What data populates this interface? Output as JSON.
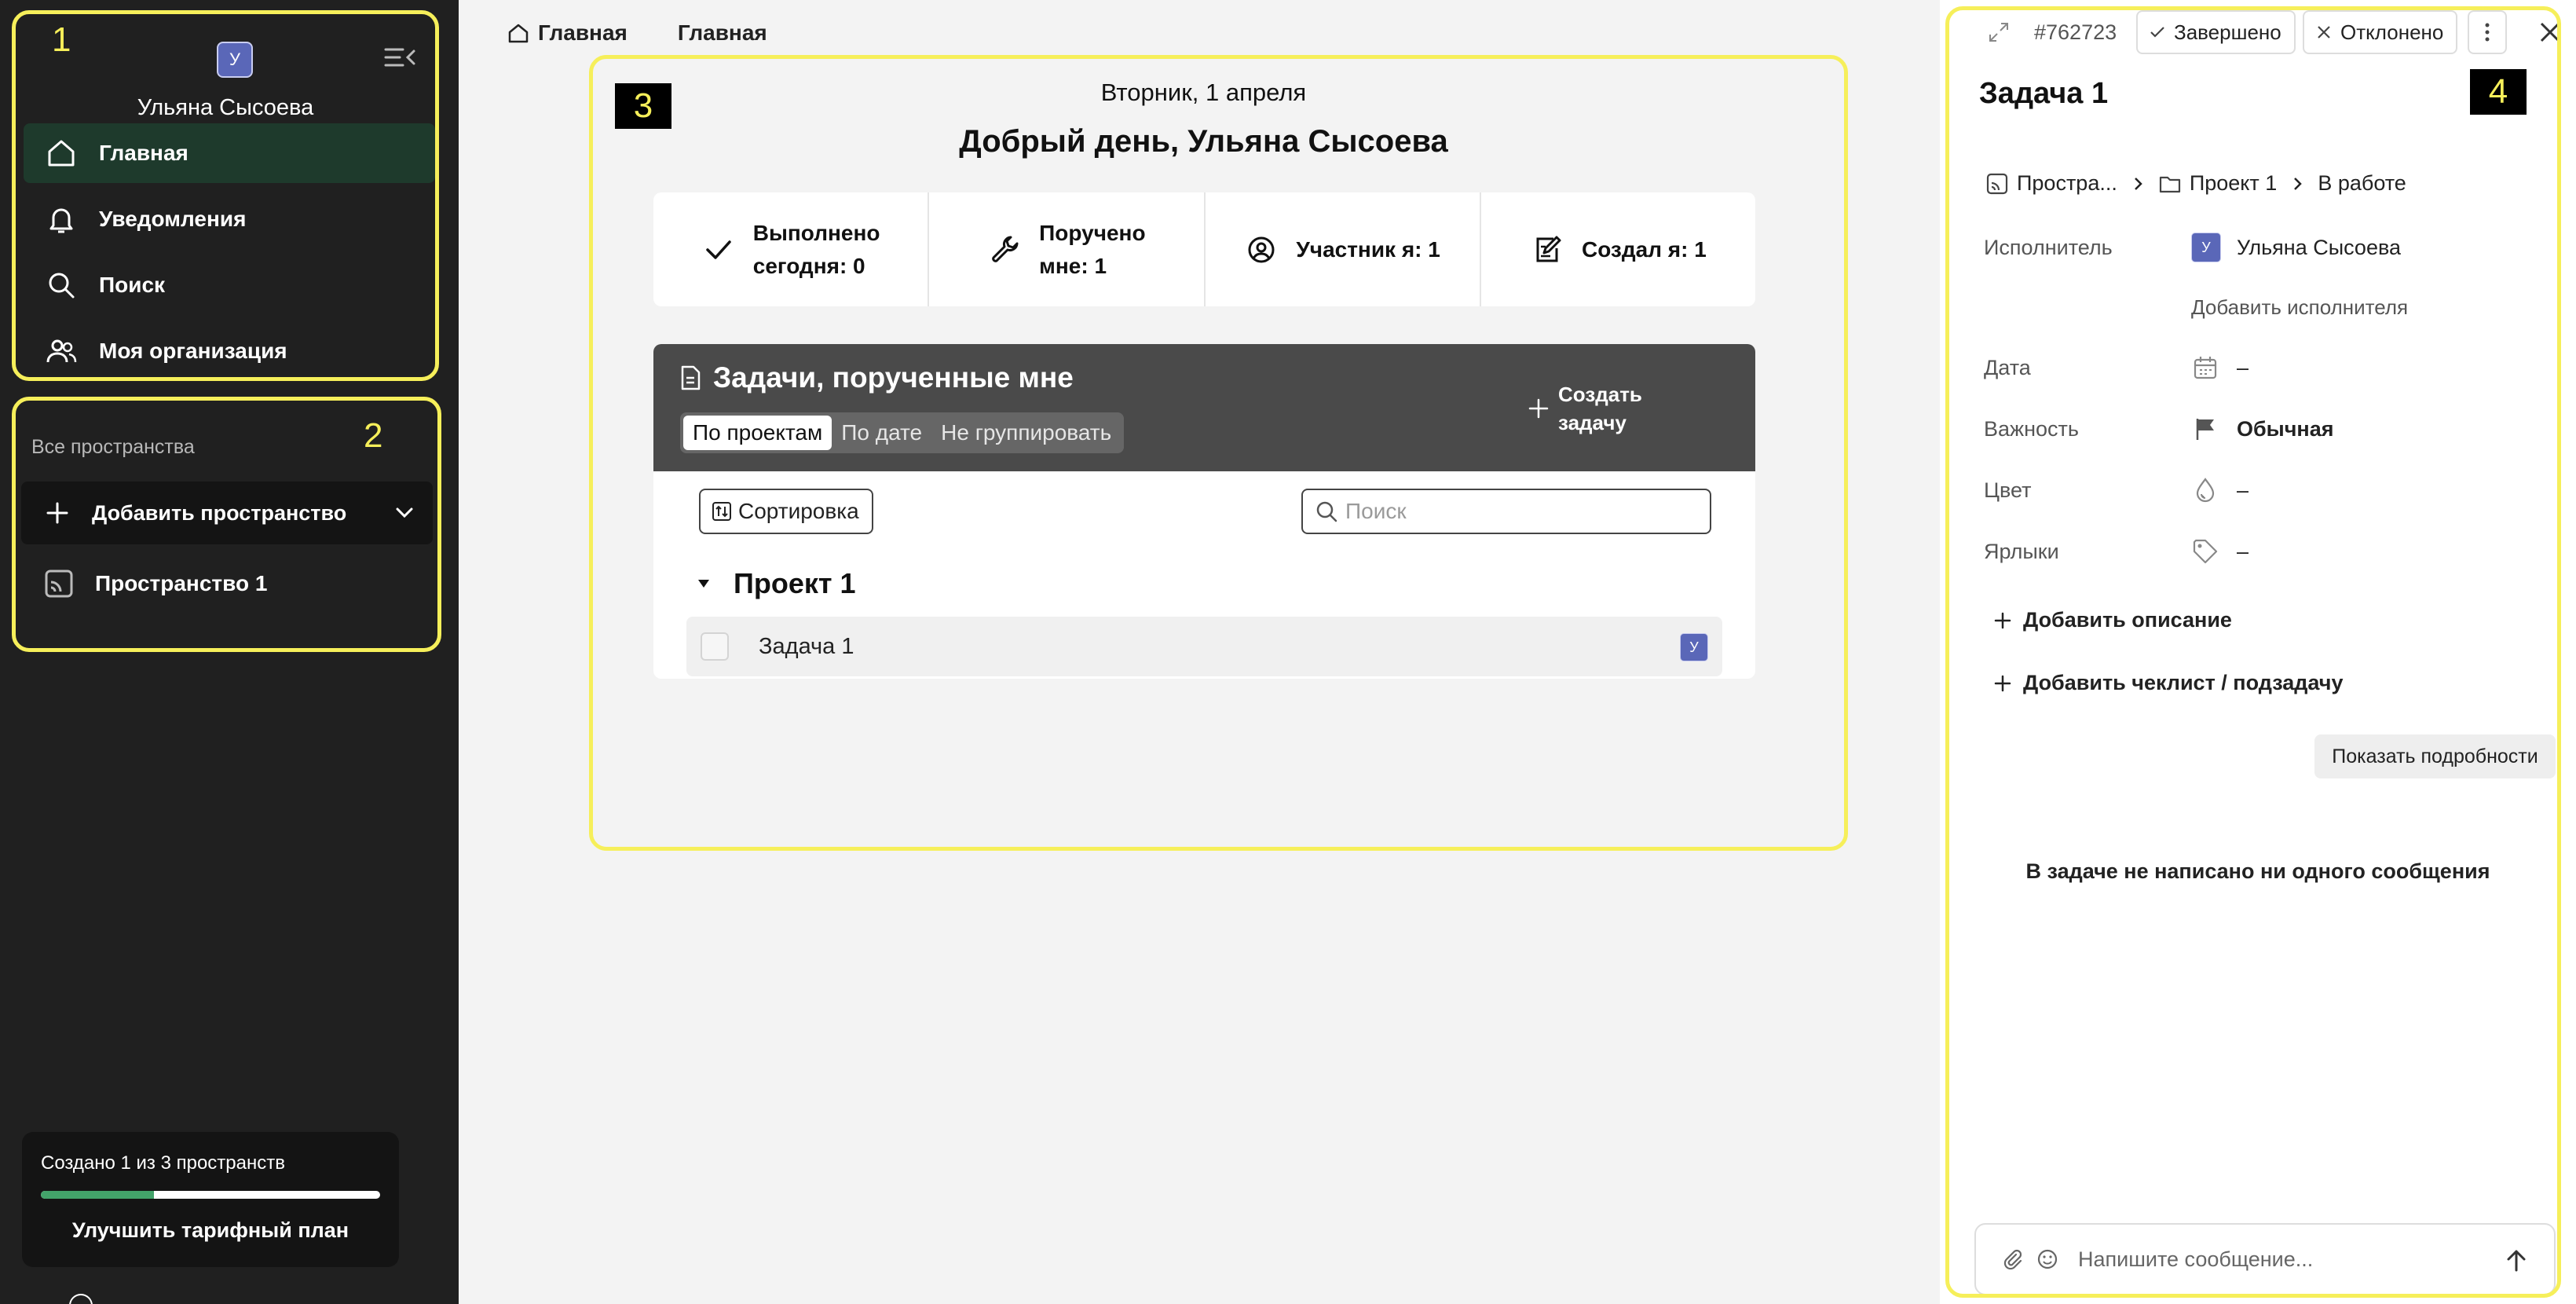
{
  "colors": {
    "sidebar_bg": "#202020",
    "active_nav": "#1e3a2c",
    "avatar": "#5a67b8",
    "annotation": "#f6ef5a",
    "progress": "#43a36a"
  },
  "sidebar": {
    "avatar_initial": "У",
    "user_name": "Ульяна Сысоева",
    "nav": [
      {
        "label": "Главная",
        "icon": "home-icon",
        "active": true
      },
      {
        "label": "Уведомления",
        "icon": "bell-icon"
      },
      {
        "label": "Поиск",
        "icon": "search-icon"
      },
      {
        "label": "Моя организация",
        "icon": "users-icon"
      }
    ],
    "spaces_label": "Все пространства",
    "add_space_label": "Добавить пространство",
    "spaces": [
      {
        "label": "Пространство 1",
        "icon": "space-icon"
      }
    ],
    "plan": {
      "text": "Создано 1 из 3 пространств",
      "progress": 0.333,
      "upgrade_label": "Улучшить тарифный план"
    }
  },
  "annotations": [
    "1",
    "2",
    "3",
    "4"
  ],
  "breadcrumb": {
    "items": [
      "Главная",
      "Главная"
    ]
  },
  "main": {
    "date": "Вторник, 1 апреля",
    "greeting": "Добрый день, Ульяна Сысоева",
    "stats": [
      {
        "line1": "Выполнено",
        "line2": "сегодня: 0",
        "icon": "check-icon"
      },
      {
        "line1": "Поручено",
        "line2": "мне: 1",
        "icon": "wrench-icon"
      },
      {
        "line1": "Участник я: 1",
        "line2": "",
        "icon": "user-circle-icon"
      },
      {
        "line1": "Создал я: 1",
        "line2": "",
        "icon": "edit-icon"
      }
    ],
    "tasks": {
      "title": "Задачи, порученные мне",
      "tabs": [
        "По проектам",
        "По дате",
        "Не группировать"
      ],
      "active_tab": 0,
      "create_line1": "Создать",
      "create_line2": "задачу",
      "sort_label": "Сортировка",
      "search_placeholder": "Поиск",
      "project": "Проект 1",
      "task_name": "Задача 1",
      "task_avatar": "У"
    }
  },
  "panel": {
    "task_id": "#762723",
    "done_label": "Завершено",
    "reject_label": "Отклонено",
    "title": "Задача 1",
    "path": {
      "space": "Простра...",
      "project": "Проект 1",
      "status": "В работе"
    },
    "executor_label": "Исполнитель",
    "executor_name": "Ульяна Сысоева",
    "executor_initial": "У",
    "add_executor": "Добавить исполнителя",
    "date_label": "Дата",
    "date_value": "–",
    "priority_label": "Важность",
    "priority_value": "Обычная",
    "color_label": "Цвет",
    "color_value": "–",
    "tags_label": "Ярлыки",
    "tags_value": "–",
    "add_description": "Добавить описание",
    "add_checklist": "Добавить чеклист / подзадачу",
    "show_details": "Показать подробности",
    "empty_messages": "В задаче не написано ни одного сообщения",
    "message_placeholder": "Напишите сообщение..."
  }
}
